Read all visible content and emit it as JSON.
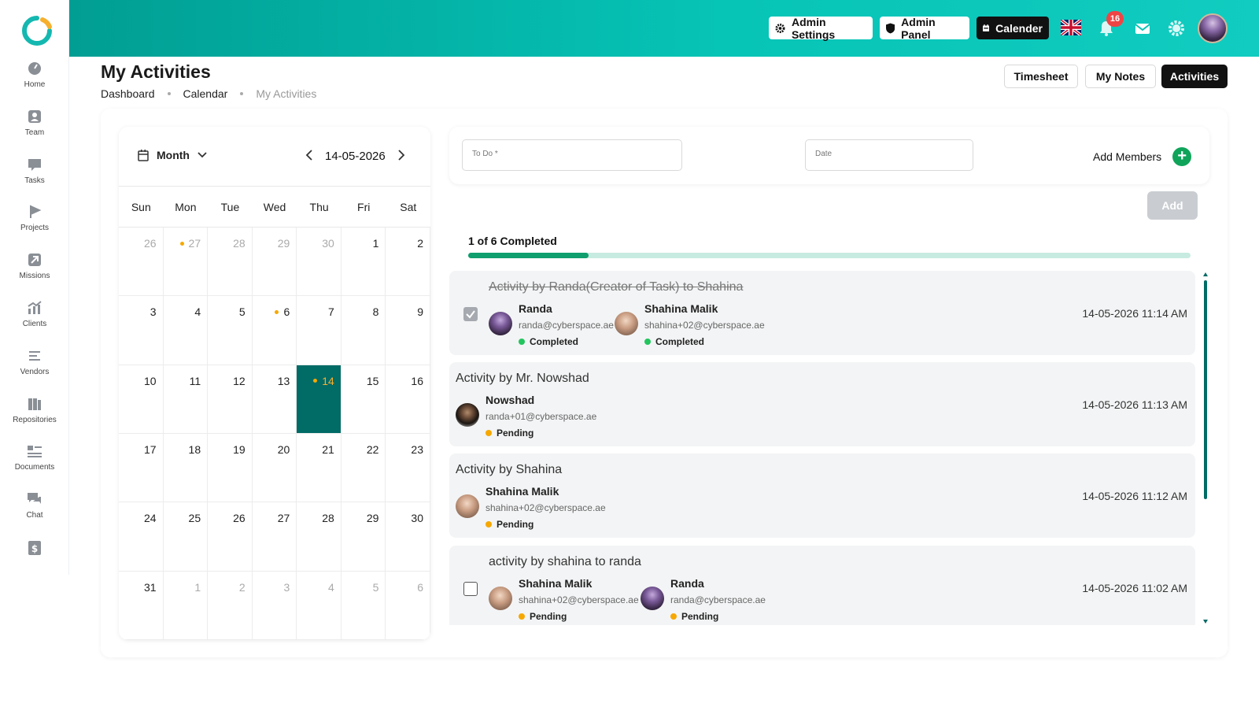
{
  "header": {
    "admin_settings": "Admin Settings",
    "admin_panel": "Admin Panel",
    "calender": "Calender",
    "notifications_count": "16",
    "accent": "#06c4b6"
  },
  "sidebar": {
    "items": [
      {
        "label": "Home",
        "icon": "gauge-icon"
      },
      {
        "label": "Team",
        "icon": "user-icon"
      },
      {
        "label": "Tasks",
        "icon": "board-icon"
      },
      {
        "label": "Projects",
        "icon": "flag-icon"
      },
      {
        "label": "Missions",
        "icon": "arrow-up-right-icon"
      },
      {
        "label": "Clients",
        "icon": "chart-icon"
      },
      {
        "label": "Vendors",
        "icon": "menu-icon"
      },
      {
        "label": "Repositories",
        "icon": "repository-icon"
      },
      {
        "label": "Documents",
        "icon": "documents-icon"
      },
      {
        "label": "Chat",
        "icon": "chat-icon"
      },
      {
        "label": "",
        "icon": "dollar-icon"
      }
    ]
  },
  "page": {
    "title": "My Activities",
    "breadcrumb": [
      "Dashboard",
      "Calendar",
      "My Activities"
    ],
    "tabs": [
      "Timesheet",
      "My Notes",
      "Activities"
    ]
  },
  "calendar": {
    "view": "Month",
    "date": "14-05-2026",
    "weekdays": [
      "Sun",
      "Mon",
      "Tue",
      "Wed",
      "Thu",
      "Fri",
      "Sat"
    ],
    "days": [
      {
        "d": "26",
        "out": true
      },
      {
        "d": "27",
        "out": true,
        "dot": true
      },
      {
        "d": "28",
        "out": true
      },
      {
        "d": "29",
        "out": true
      },
      {
        "d": "30",
        "out": true
      },
      {
        "d": "1"
      },
      {
        "d": "2"
      },
      {
        "d": "3"
      },
      {
        "d": "4"
      },
      {
        "d": "5"
      },
      {
        "d": "6",
        "dot": true
      },
      {
        "d": "7"
      },
      {
        "d": "8"
      },
      {
        "d": "9"
      },
      {
        "d": "10"
      },
      {
        "d": "11"
      },
      {
        "d": "12"
      },
      {
        "d": "13"
      },
      {
        "d": "14",
        "dot": true,
        "today": true
      },
      {
        "d": "15"
      },
      {
        "d": "16"
      },
      {
        "d": "17"
      },
      {
        "d": "18"
      },
      {
        "d": "19"
      },
      {
        "d": "20"
      },
      {
        "d": "21"
      },
      {
        "d": "22"
      },
      {
        "d": "23"
      },
      {
        "d": "24"
      },
      {
        "d": "25"
      },
      {
        "d": "26"
      },
      {
        "d": "27"
      },
      {
        "d": "28"
      },
      {
        "d": "29"
      },
      {
        "d": "30"
      },
      {
        "d": "31"
      },
      {
        "d": "1",
        "out": true
      },
      {
        "d": "2",
        "out": true
      },
      {
        "d": "3",
        "out": true
      },
      {
        "d": "4",
        "out": true
      },
      {
        "d": "5",
        "out": true
      },
      {
        "d": "6",
        "out": true
      }
    ]
  },
  "form": {
    "todo_placeholder": "To Do *",
    "date_placeholder": "Date",
    "add_members": "Add Members",
    "add_button": "Add"
  },
  "progress": {
    "label": "1 of 6 Completed",
    "completed": 1,
    "total": 6
  },
  "activities": [
    {
      "title": "Activity by Randa(Creator of Task) to Shahina",
      "done": true,
      "checkbox": true,
      "checked": true,
      "time": "14-05-2026 11:14 AM",
      "people": [
        {
          "name": "Randa",
          "email": "randa@cyberspace.ae",
          "status": "Completed",
          "avatar": "randa"
        },
        {
          "name": "Shahina Malik",
          "email": "shahina+02@cyberspace.ae",
          "status": "Completed",
          "avatar": "shahina"
        }
      ]
    },
    {
      "title": "Activity by Mr. Nowshad",
      "done": false,
      "checkbox": false,
      "time": "14-05-2026 11:13 AM",
      "people": [
        {
          "name": "Nowshad",
          "email": "randa+01@cyberspace.ae",
          "status": "Pending",
          "avatar": "nowshad"
        }
      ]
    },
    {
      "title": "Activity by Shahina",
      "done": false,
      "checkbox": false,
      "time": "14-05-2026 11:12 AM",
      "people": [
        {
          "name": "Shahina Malik",
          "email": "shahina+02@cyberspace.ae",
          "status": "Pending",
          "avatar": "shahina"
        }
      ]
    },
    {
      "title": "activity by shahina to randa",
      "done": false,
      "checkbox": true,
      "checked": false,
      "time": "14-05-2026 11:02 AM",
      "people": [
        {
          "name": "Shahina Malik",
          "email": "shahina+02@cyberspace.ae",
          "status": "Pending",
          "avatar": "shahina"
        },
        {
          "name": "Randa",
          "email": "randa@cyberspace.ae",
          "status": "Pending",
          "avatar": "randa"
        }
      ]
    }
  ],
  "status_colors": {
    "Completed": "#22c55e",
    "Pending": "#f6a800"
  }
}
